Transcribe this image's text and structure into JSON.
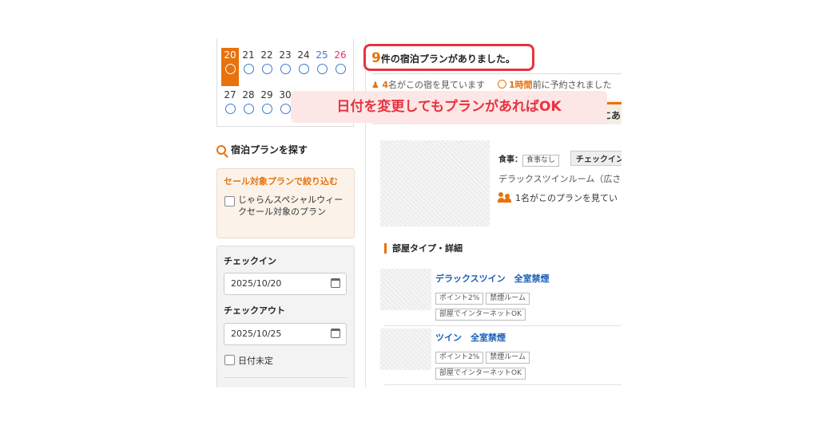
{
  "calendar": {
    "weeks": [
      [
        {
          "num": "20",
          "sel": true,
          "type": "weekday"
        },
        {
          "num": "21",
          "type": "weekday"
        },
        {
          "num": "22",
          "type": "weekday"
        },
        {
          "num": "23",
          "type": "weekday"
        },
        {
          "num": "24",
          "type": "weekday"
        },
        {
          "num": "25",
          "type": "sat"
        },
        {
          "num": "26",
          "type": "sun"
        }
      ],
      [
        {
          "num": "27",
          "type": "weekday"
        },
        {
          "num": "28",
          "type": "weekday"
        },
        {
          "num": "29",
          "type": "weekday"
        },
        {
          "num": "30",
          "type": "weekday"
        }
      ]
    ],
    "availability_mark": "○"
  },
  "sidebar": {
    "search_title": "宿泊プランを探す",
    "sale_filter": {
      "heading": "セール対象プランで絞り込む",
      "option_label": "じゃらんスペシャルウィークセール対象のプラン",
      "checked": false
    },
    "checkin_label": "チェックイン",
    "checkin_value": "2025/10/20",
    "checkout_label": "チェックアウト",
    "checkout_value": "2025/10/25",
    "undecided_label": "日付未定",
    "undecided_checked": false
  },
  "main": {
    "plan_count": "9",
    "plan_count_suffix": "件の宿泊プランがありました。",
    "watchers_count": "4",
    "watchers_text": "名がこの宿を見ています",
    "booked_time": "1時間",
    "booked_text": "前に予約されました",
    "banner_suffix": "にあ",
    "callout": "日付を変更してもプランがあればOK",
    "plan_card": {
      "meal_label": "食事：",
      "meal_value": "食事なし",
      "checkin_tag": "チェックイン",
      "room_desc": "デラックスツインルーム（広さ",
      "viewers_text": "1名がこのプランを見てい"
    },
    "room_section_title": "部屋タイプ・詳細",
    "rooms": [
      {
        "name": "デラックスツイン　全室禁煙",
        "tags": [
          "ポイント2%",
          "禁煙ルーム"
        ],
        "tags2": [
          "部屋でインターネットOK"
        ]
      },
      {
        "name": "ツイン　全室禁煙",
        "tags": [
          "ポイント2%",
          "禁煙ルーム"
        ],
        "tags2": [
          "部屋でインターネットOK"
        ]
      }
    ]
  },
  "colors": {
    "accent": "#e8720c",
    "highlight_red": "#e73340",
    "link_blue": "#1a5fb4",
    "sat_blue": "#3a7bd5",
    "sun_red": "#e0336b"
  }
}
